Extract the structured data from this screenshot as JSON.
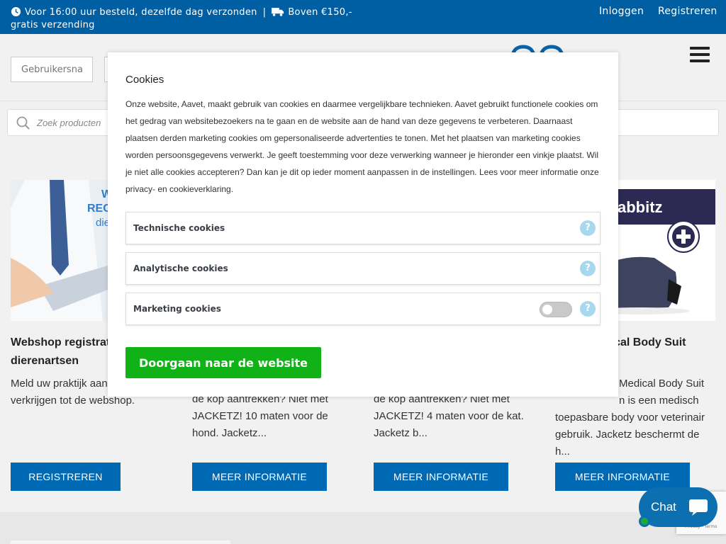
{
  "topbar": {
    "promo_part1": "Voor 16:00 uur besteld, dezelfde dag verzonden",
    "separator": "|",
    "promo_part2": "Boven €150,-",
    "promo_part3": "gratis verzending",
    "login": "Inloggen",
    "register": "Registreren"
  },
  "header": {
    "username_placeholder": "Gebruikersnaam"
  },
  "search": {
    "placeholder": "Zoek producten"
  },
  "products": [
    {
      "title": "Webshop registratie dierenartsen",
      "title_visible": "Webshop registrat dierenartsen",
      "desc": "Meld uw praktijk aan toegang te verkrijgen tot de webshop.",
      "button": "REGISTREREN",
      "image_text": "W REG die"
    },
    {
      "desc_visible": "de kop aantrekken? Niet met JACKETZ! 10 maten voor de hond. Jacketz...",
      "button": "MEER INFORMATIE"
    },
    {
      "desc_visible": "de kop aantrekken? Niet met JACKETZ! 4 maten voor de kat. Jacketz b...",
      "button": "MEER INFORMATIE"
    },
    {
      "title_visible": "edical Body Suit",
      "desc_visible_lines": [
        "Medical Body Suit",
        "n is een medisch",
        "toepasbare body voor veterinair",
        "gebruik. Jacketz beschermt de",
        "h..."
      ],
      "button": "MEER INFORMATIE",
      "image_text": "abbitz"
    }
  ],
  "cookie_modal": {
    "title": "Cookies",
    "text": "Onze website, Aavet, maakt gebruik van cookies en daarmee vergelijkbare technieken. Aavet gebruikt functionele cookies om het gedrag van websitebezoekers na te gaan en de website aan de hand van deze gegevens te verbeteren. Daarnaast plaatsen derden marketing cookies om gepersonaliseerde advertenties te tonen. Met het plaatsen van marketing cookies worden persoonsgegevens verwerkt. Je geeft toestemming voor deze verwerking wanneer je hieronder een vinkje plaatst. Wil je niet alle cookies accepteren? Dan kan je dit op ieder moment aanpassen in de instellingen. Lees voor meer informatie onze privacy- en cookieverklaring.",
    "options": [
      {
        "label": "Technische cookies",
        "has_toggle": false
      },
      {
        "label": "Analytische cookies",
        "has_toggle": false
      },
      {
        "label": "Marketing cookies",
        "has_toggle": true,
        "enabled": false
      }
    ],
    "help_symbol": "?",
    "continue_button": "Doorgaan naar de website"
  },
  "chat": {
    "label": "Chat",
    "status_color": "#21a638"
  },
  "colors": {
    "brand_blue": "#005fa3",
    "button_blue": "#0069b4",
    "green_button": "#10b217",
    "help_bubble": "#a8d8ee"
  },
  "icons": [
    "clock-icon",
    "truck-icon",
    "search-icon",
    "hamburger-menu-icon",
    "help-icon",
    "chat-bubble-icon",
    "logo"
  ]
}
